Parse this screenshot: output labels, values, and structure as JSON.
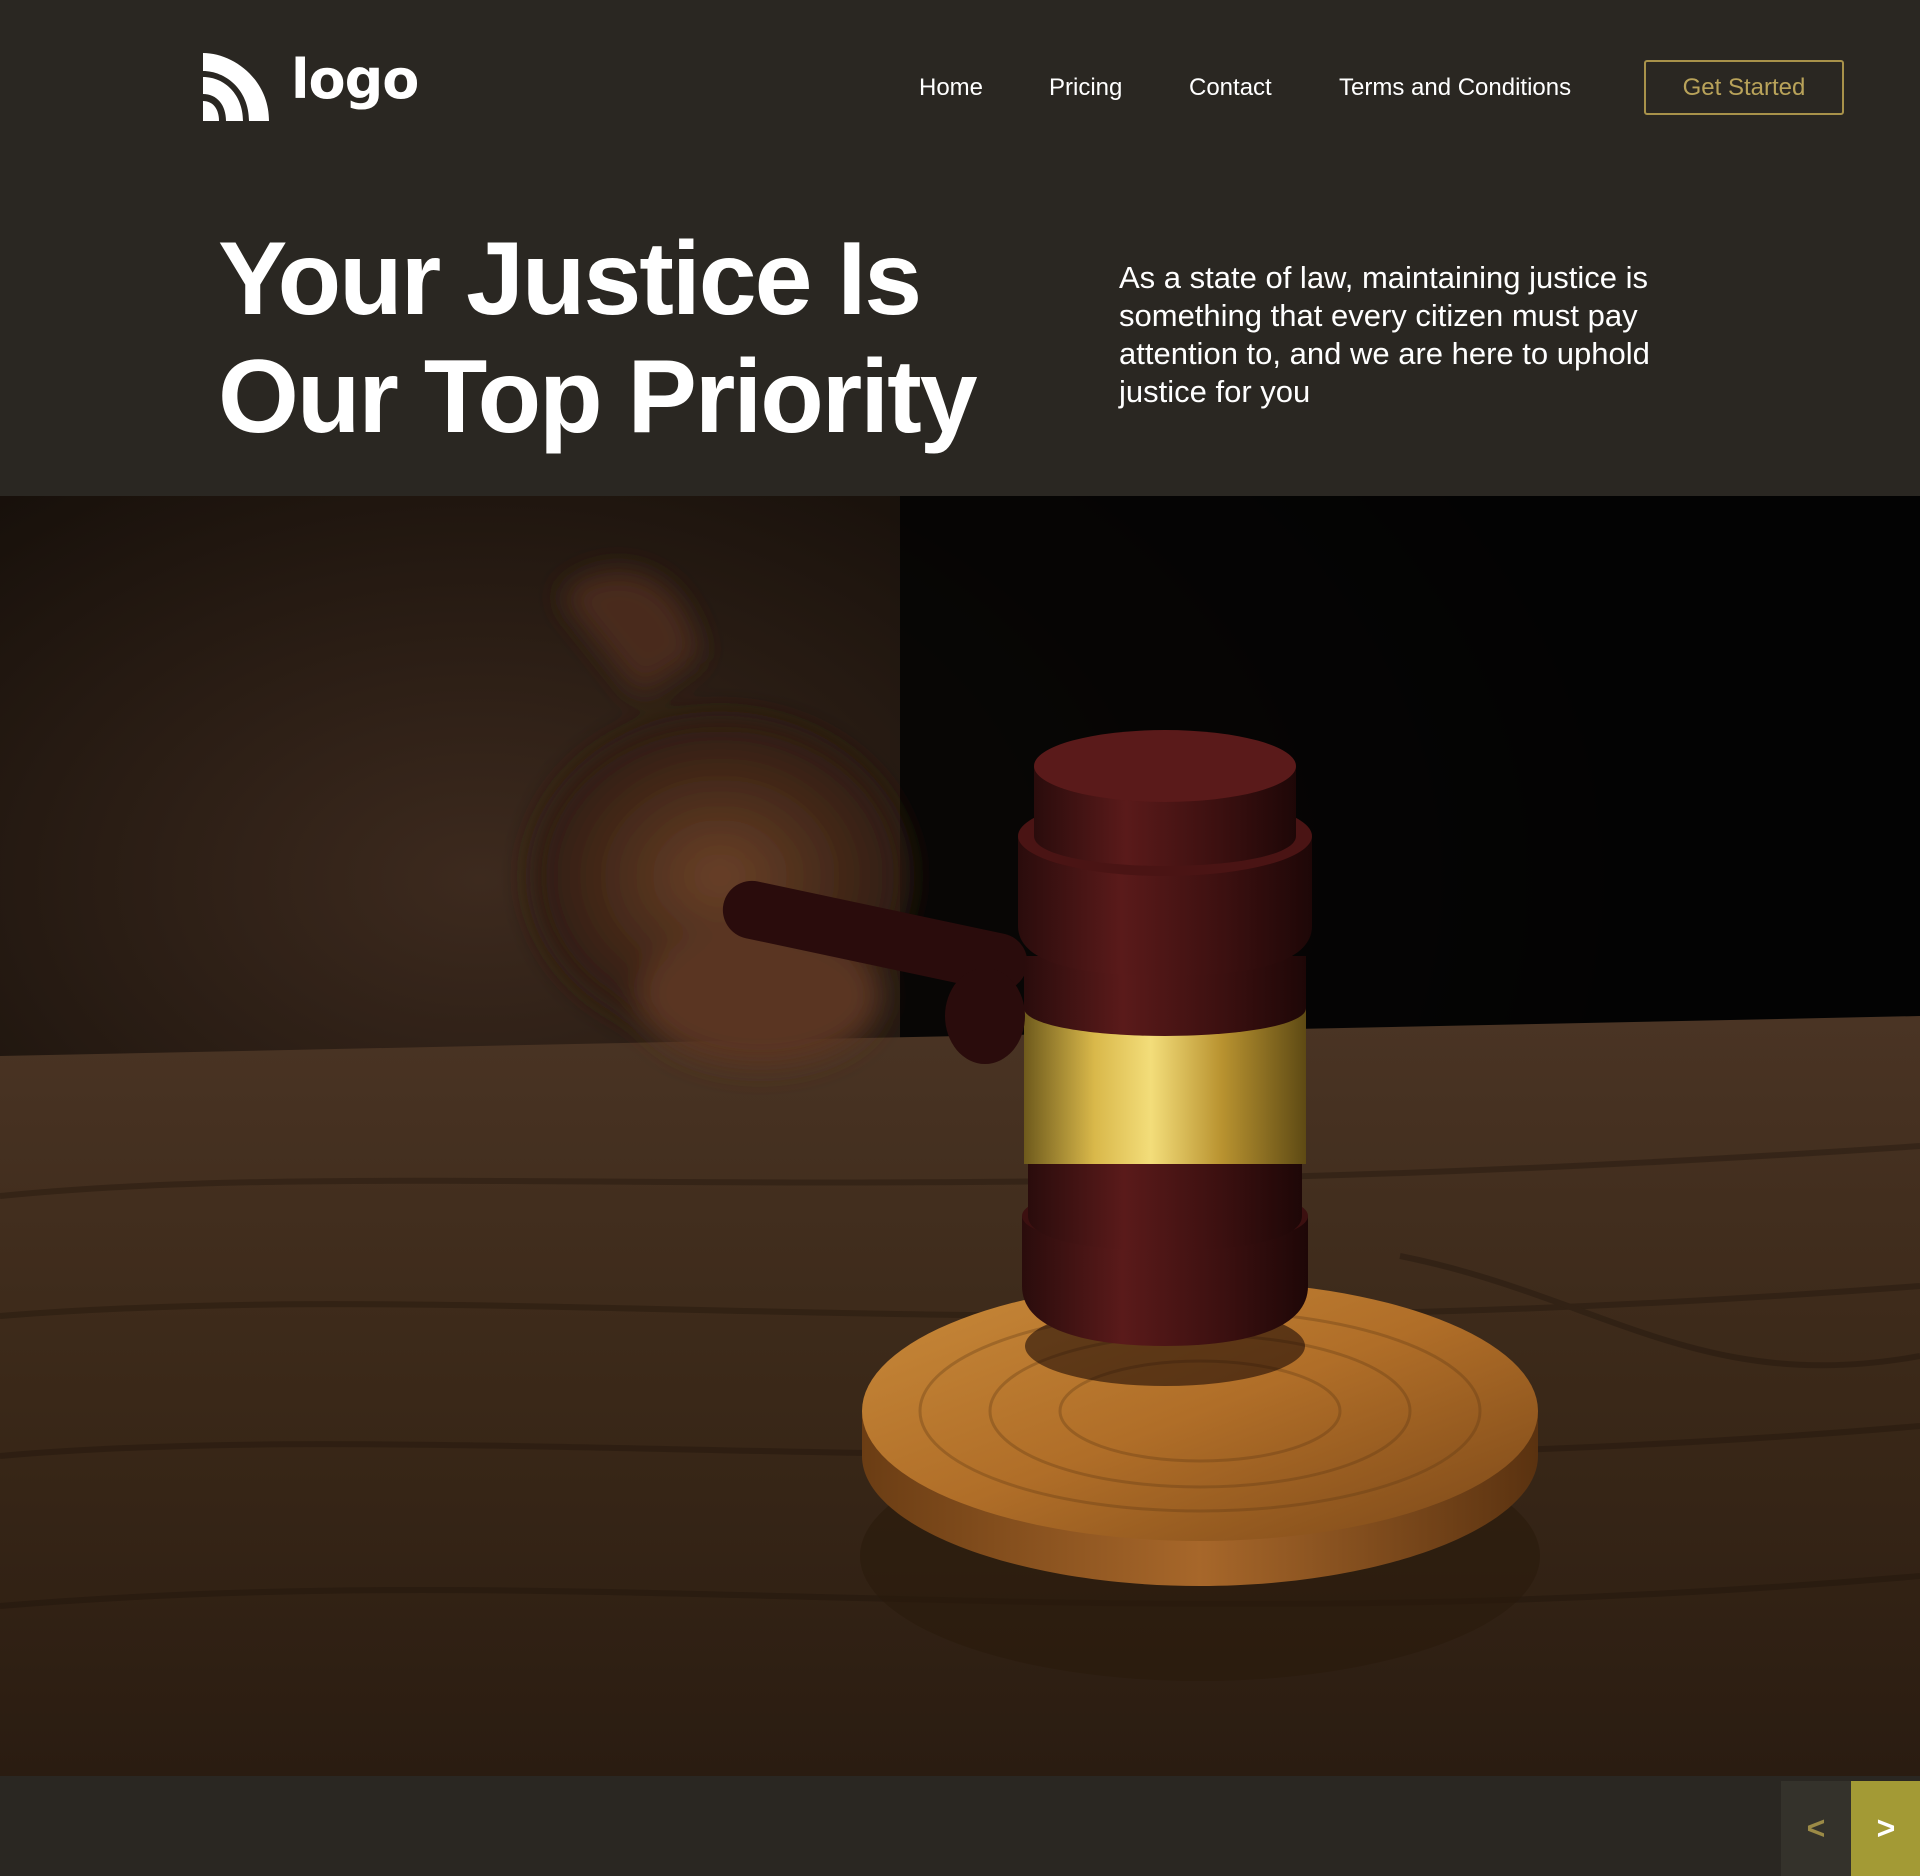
{
  "brand": {
    "logo_text": "logo",
    "accent_color": "#a39a35",
    "button_border_color": "#a8924a",
    "background_color": "#2a2722"
  },
  "nav": {
    "items": [
      {
        "label": "Home"
      },
      {
        "label": "Pricing"
      },
      {
        "label": "Contact"
      },
      {
        "label": "Terms and Conditions"
      }
    ],
    "cta_label": "Get Started"
  },
  "hero": {
    "title_line1": "Your Justice Is",
    "title_line2": "Our Top Priority",
    "description": "As a state of law, maintaining justice is something that every citizen must pay attention to, and we are here to uphold justice for you"
  },
  "slider": {
    "prev_label": "<",
    "next_label": ">"
  }
}
